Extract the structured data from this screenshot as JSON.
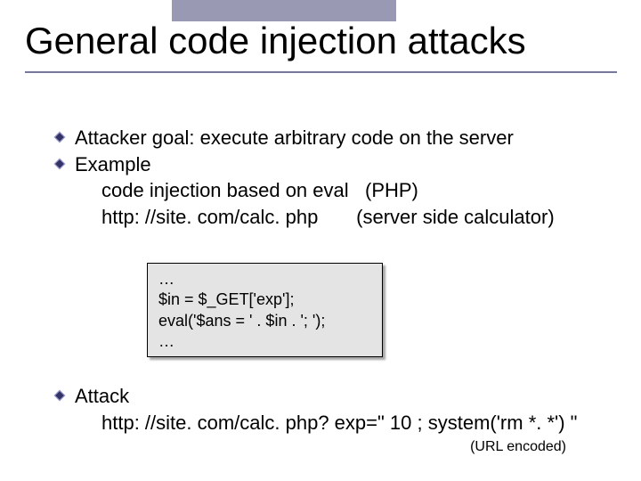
{
  "header": {
    "title": "General code injection attacks"
  },
  "bullets": {
    "goal": "Attacker goal: execute arbitrary code on the server",
    "example_label": "Example",
    "example_line1a": "code injection based on ",
    "example_eval": "eval",
    "example_line1b": "   (PHP)",
    "example_line2a": "http: //site. com/calc. php",
    "example_line2b": "       (server side calculator)"
  },
  "code": {
    "l1": "…",
    "l2": "$in = $_GET['exp'];",
    "l3": "eval('$ans = ' . $in . '; ');",
    "l4": "…"
  },
  "attack": {
    "label": "Attack",
    "url": "http: //site. com/calc. php? exp=\" 10 ; system('rm *. *') \"",
    "encoded": "(URL encoded)"
  }
}
